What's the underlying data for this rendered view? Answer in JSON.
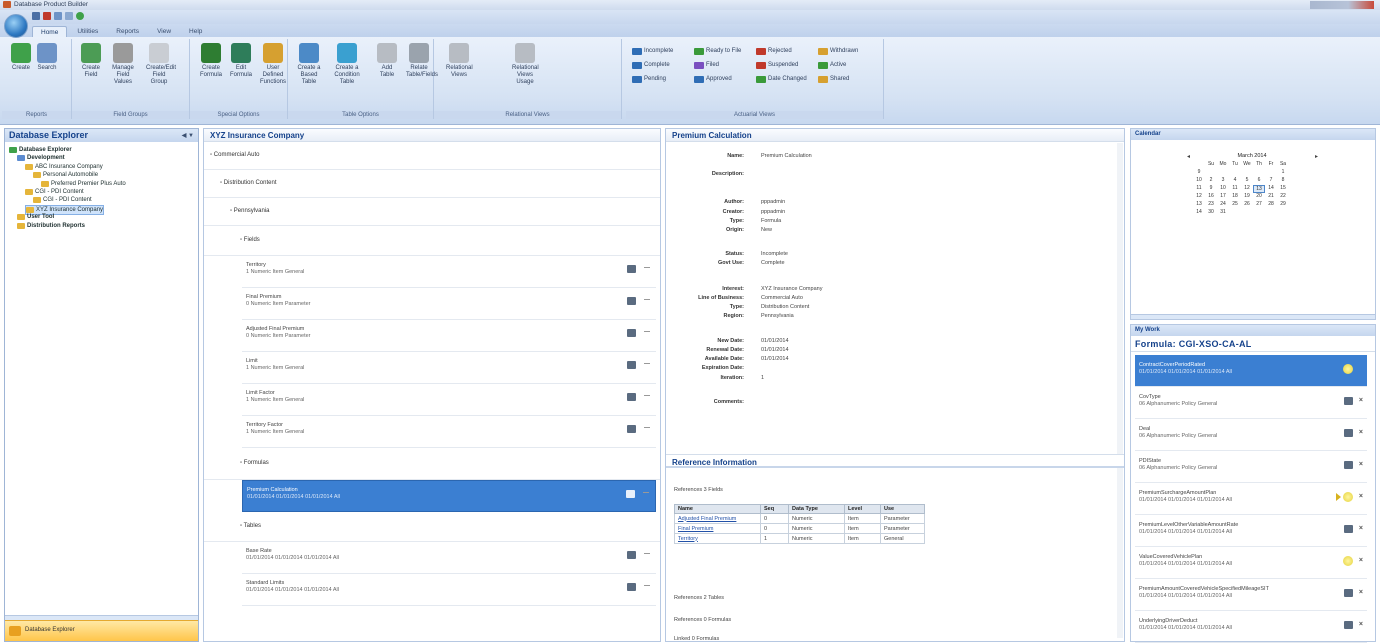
{
  "window": {
    "title": "Database Product Builder"
  },
  "tabs": [
    "Home",
    "Utilities",
    "Reports",
    "View",
    "Help"
  ],
  "ribbon": {
    "groups": [
      "Reports",
      "Field Groups",
      "Special Options",
      "Table Options",
      "Relational Views",
      "Actuarial Views"
    ],
    "buttons": [
      {
        "label": "Create",
        "color": "#3fa14a"
      },
      {
        "label": "Search",
        "color": "#6d93c7"
      },
      {
        "label": "Create Field",
        "color": "#4c9c55"
      },
      {
        "label": "Manage Field Values",
        "color": "#9a9a9a"
      },
      {
        "label": "Create/Edit Field Group",
        "color": "#c9cdd3"
      },
      {
        "label": "Create Formula",
        "color": "#2e7d32"
      },
      {
        "label": "Edit Formula",
        "color": "#2e7d5a"
      },
      {
        "label": "User Defined Functions",
        "color": "#d6a030"
      },
      {
        "label": "Create a Based Table",
        "color": "#4c8ac7"
      },
      {
        "label": "Create a Condition Table",
        "color": "#3aa0d0"
      },
      {
        "label": "Add Table",
        "color": "#b7bcc3"
      },
      {
        "label": "Relate Table/Fields",
        "color": "#9aa3ad"
      },
      {
        "label": "Relational Views",
        "color": "#b7bcc3"
      },
      {
        "label": "Relational Views Usage",
        "color": "#b7bcc3"
      }
    ],
    "status_buttons": [
      {
        "label": "Incomplete",
        "color": "#2f6db5"
      },
      {
        "label": "Complete",
        "color": "#2f6db5"
      },
      {
        "label": "Pending",
        "color": "#2f6db5"
      },
      {
        "label": "Ready to File",
        "color": "#3a9a3a"
      },
      {
        "label": "Filed",
        "color": "#7a4fc0"
      },
      {
        "label": "Approved",
        "color": "#2f6db5"
      },
      {
        "label": "Rejected",
        "color": "#c0392b"
      },
      {
        "label": "Suspended",
        "color": "#c0392b"
      },
      {
        "label": "Date Changed",
        "color": "#3a9a3a"
      },
      {
        "label": "Withdrawn",
        "color": "#d6a030"
      },
      {
        "label": "Active",
        "color": "#3a9a3a"
      },
      {
        "label": "Shared",
        "color": "#d6a030"
      }
    ]
  },
  "explorer": {
    "title": "Database Explorer",
    "tree": [
      {
        "label": "Database Explorer",
        "level": 0,
        "color": "#3fa14a",
        "bold": true
      },
      {
        "label": "Development",
        "level": 1,
        "color": "#5b8bd0",
        "bold": true
      },
      {
        "label": "ABC Insurance Company",
        "level": 2,
        "color": "#e5b53a"
      },
      {
        "label": "Personal Automobile",
        "level": 3,
        "color": "#e5b53a"
      },
      {
        "label": "Preferred Premier Plus Auto",
        "level": 4,
        "color": "#e5b53a"
      },
      {
        "label": "CGI - PDI Content",
        "level": 2,
        "color": "#e5b53a"
      },
      {
        "label": "CGI - PDI Content",
        "level": 3,
        "color": "#e5b53a"
      },
      {
        "label": "XYZ Insurance Company",
        "level": 2,
        "color": "#e5b53a",
        "selected": true
      },
      {
        "label": "User Tool",
        "level": 1,
        "color": "#e5b53a",
        "bold": true
      },
      {
        "label": "Distribution Reports",
        "level": 1,
        "color": "#e5b53a",
        "bold": true
      }
    ],
    "bottom_button": "Database Explorer"
  },
  "center": {
    "title": "XYZ Insurance Company",
    "sections": [
      {
        "label": "Commercial Auto",
        "indent": 0
      },
      {
        "label": "Distribution Content",
        "indent": 1
      },
      {
        "label": "Pennsylvania",
        "indent": 2
      },
      {
        "label": "Fields",
        "indent": 3
      }
    ],
    "fields": [
      {
        "name": "Territory",
        "meta": "1  Numeric  Item  General"
      },
      {
        "name": "Final Premium",
        "meta": "0  Numeric  Item  Parameter"
      },
      {
        "name": "Adjusted Final Premium",
        "meta": "0  Numeric  Item  Parameter"
      },
      {
        "name": "Limit",
        "meta": "1  Numeric  Item  General"
      },
      {
        "name": "Limit Factor",
        "meta": "1  Numeric  Item  General"
      },
      {
        "name": "Territory Factor",
        "meta": "1  Numeric  Item  General"
      }
    ],
    "formulas_label": "Formulas",
    "formulas": [
      {
        "name": "Premium Calculation",
        "meta": "01/01/2014  01/01/2014  01/01/2014  All"
      }
    ],
    "tables_label": "Tables",
    "tables": [
      {
        "name": "Base Rate",
        "meta": "01/01/2014  01/01/2014  01/01/2014  All"
      },
      {
        "name": "Standard Limits",
        "meta": "01/01/2014  01/01/2014  01/01/2014  All"
      }
    ]
  },
  "detail": {
    "title": "Premium Calculation",
    "fields": [
      {
        "k": "Name:",
        "v": "Premium Calculation"
      },
      {
        "k": "Description:",
        "v": ""
      },
      {
        "k": "Author:",
        "v": "pppadmin"
      },
      {
        "k": "Creator:",
        "v": "pppadmin"
      },
      {
        "k": "Type:",
        "v": "Formula"
      },
      {
        "k": "Origin:",
        "v": "New"
      },
      {
        "k": "Status:",
        "v": "Incomplete"
      },
      {
        "k": "Govt Use:",
        "v": "Complete"
      },
      {
        "k": "Interest:",
        "v": "XYZ Insurance Company"
      },
      {
        "k": "Line of Business:",
        "v": "Commercial Auto"
      },
      {
        "k": "Type:",
        "v": "Distribution Content"
      },
      {
        "k": "Region:",
        "v": "Pennsylvania"
      },
      {
        "k": "New Date:",
        "v": "01/01/2014"
      },
      {
        "k": "Renewal Date:",
        "v": "01/01/2014"
      },
      {
        "k": "Available Date:",
        "v": "01/01/2014"
      },
      {
        "k": "Expiration Date:",
        "v": ""
      },
      {
        "k": "Iteration:",
        "v": "1"
      },
      {
        "k": "Comments:",
        "v": ""
      }
    ],
    "ref_title": "Reference Information",
    "ref_fields_label": "References 3 Fields",
    "ref_columns": [
      "Name",
      "Seq",
      "Data Type",
      "Level",
      "Use"
    ],
    "ref_rows": [
      [
        "Adjusted Final Premium",
        "0",
        "Numeric",
        "Item",
        "Parameter"
      ],
      [
        "Final Premium",
        "0",
        "Numeric",
        "Item",
        "Parameter"
      ],
      [
        "Territory",
        "1",
        "Numeric",
        "Item",
        "General"
      ]
    ],
    "ref_tables_label": "References 2 Tables",
    "ref_formulas_label": "References 0 Formulas",
    "ref_more_label": "Linked 0 Formulas"
  },
  "calendar": {
    "title": "Calendar",
    "month": "March  2014",
    "weekdays": [
      "Su",
      "Mo",
      "Tu",
      "We",
      "Th",
      "Fr",
      "Sa"
    ],
    "weeks": [
      [
        "9",
        "",
        "",
        "",
        "",
        "",
        "",
        "1"
      ],
      [
        "10",
        "2",
        "3",
        "4",
        "5",
        "6",
        "7",
        "8"
      ],
      [
        "11",
        "9",
        "10",
        "11",
        "12",
        "13",
        "14",
        "15"
      ],
      [
        "12",
        "16",
        "17",
        "18",
        "19",
        "20",
        "21",
        "22"
      ],
      [
        "13",
        "23",
        "24",
        "25",
        "26",
        "27",
        "28",
        "29"
      ],
      [
        "14",
        "30",
        "31",
        "",
        "",
        "",
        "",
        ""
      ]
    ],
    "today": "13"
  },
  "mywork": {
    "title": "My Work",
    "heading": "Formula: CGI-XSO-CA-AL",
    "items": [
      {
        "name": "ContractCoverPeriodRated",
        "meta": "01/01/2014  01/01/2014  01/01/2014  All",
        "icon": "bulb",
        "selected": true
      },
      {
        "name": "CovType",
        "meta": "06  Alphanumeric  Policy  General",
        "icon": "box"
      },
      {
        "name": "Deal",
        "meta": "06  Alphanumeric  Policy  General",
        "icon": "box"
      },
      {
        "name": "PDIState",
        "meta": "06  Alphanumeric  Policy  General",
        "icon": "box"
      },
      {
        "name": "PremiumSurchargeAmountPlan",
        "meta": "01/01/2014  01/01/2014  01/01/2014  All",
        "icon": "arrow-bulb"
      },
      {
        "name": "PremiumLevelOtherVariableAmountRate",
        "meta": "01/01/2014  01/01/2014  01/01/2014  All",
        "icon": "box"
      },
      {
        "name": "ValueCoveredVehiclePlan",
        "meta": "01/01/2014  01/01/2014  01/01/2014  All",
        "icon": "bulb"
      },
      {
        "name": "PremiumAmountCoveredVehicleSpecifiedMileageSIT",
        "meta": "01/01/2014  01/01/2014  01/01/2014  All",
        "icon": "box"
      },
      {
        "name": "UnderlyingDriverDeduct",
        "meta": "01/01/2014  01/01/2014  01/01/2014  All",
        "icon": "box"
      }
    ]
  }
}
